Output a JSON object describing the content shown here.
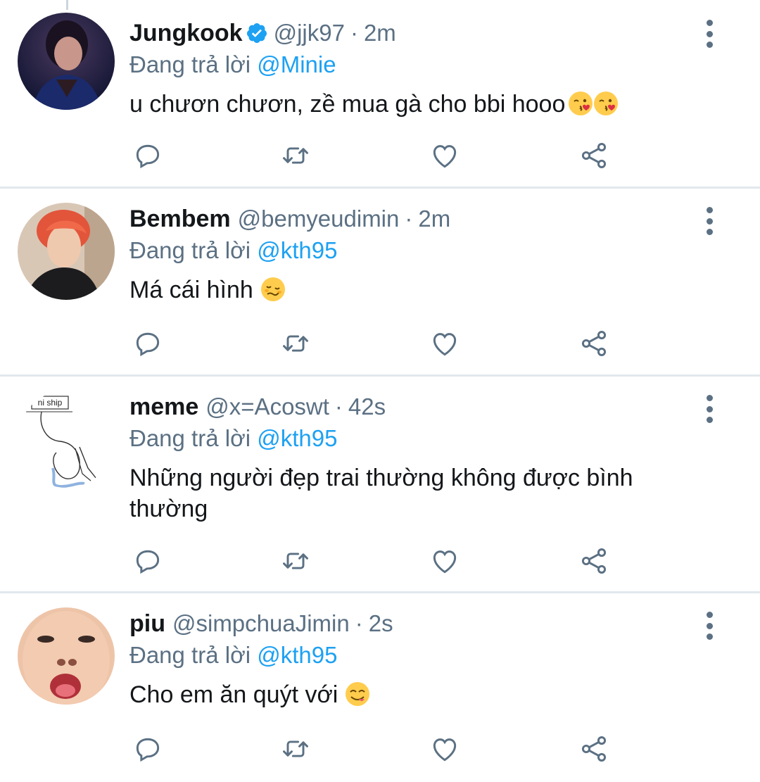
{
  "reply_prefix": "Đang trả lời",
  "colors": {
    "link": "#1da1f2",
    "secondary_text": "#5b7083",
    "divider": "#e1e8ed",
    "verified": "#1da1f2"
  },
  "tweets": [
    {
      "display_name": "Jungkook",
      "verified": true,
      "handle": "@jjk97",
      "separator": "·",
      "time": "2m",
      "reply_to": "@Minie",
      "text": "u chươn chươn, zề mua gà cho bbi hooo",
      "emojis": [
        "kissing-heart-emoji",
        "kissing-heart-emoji"
      ],
      "avatar": "avatar-photo"
    },
    {
      "display_name": "Bembem",
      "verified": false,
      "handle": "@bemyeudimin",
      "separator": "·",
      "time": "2m",
      "reply_to": "@kth95",
      "text": "Má cái hình",
      "emojis": [
        "woozy-face-emoji"
      ],
      "avatar": "avatar-photo"
    },
    {
      "display_name": "meme",
      "verified": false,
      "handle": "@x=Acoswt",
      "separator": "·",
      "time": "42s",
      "reply_to": "@kth95",
      "text": "Những người đẹp trai thường không được bình thường",
      "emojis": [],
      "avatar": "avatar-drawing"
    },
    {
      "display_name": "piu",
      "verified": false,
      "handle": "@simpchuaJimin",
      "separator": "·",
      "time": "2s",
      "reply_to": "@kth95",
      "text": "Cho em ăn quýt với",
      "emojis": [
        "yum-face-emoji"
      ],
      "avatar": "avatar-photo"
    }
  ],
  "avatar_sketch_text": "ni ship"
}
